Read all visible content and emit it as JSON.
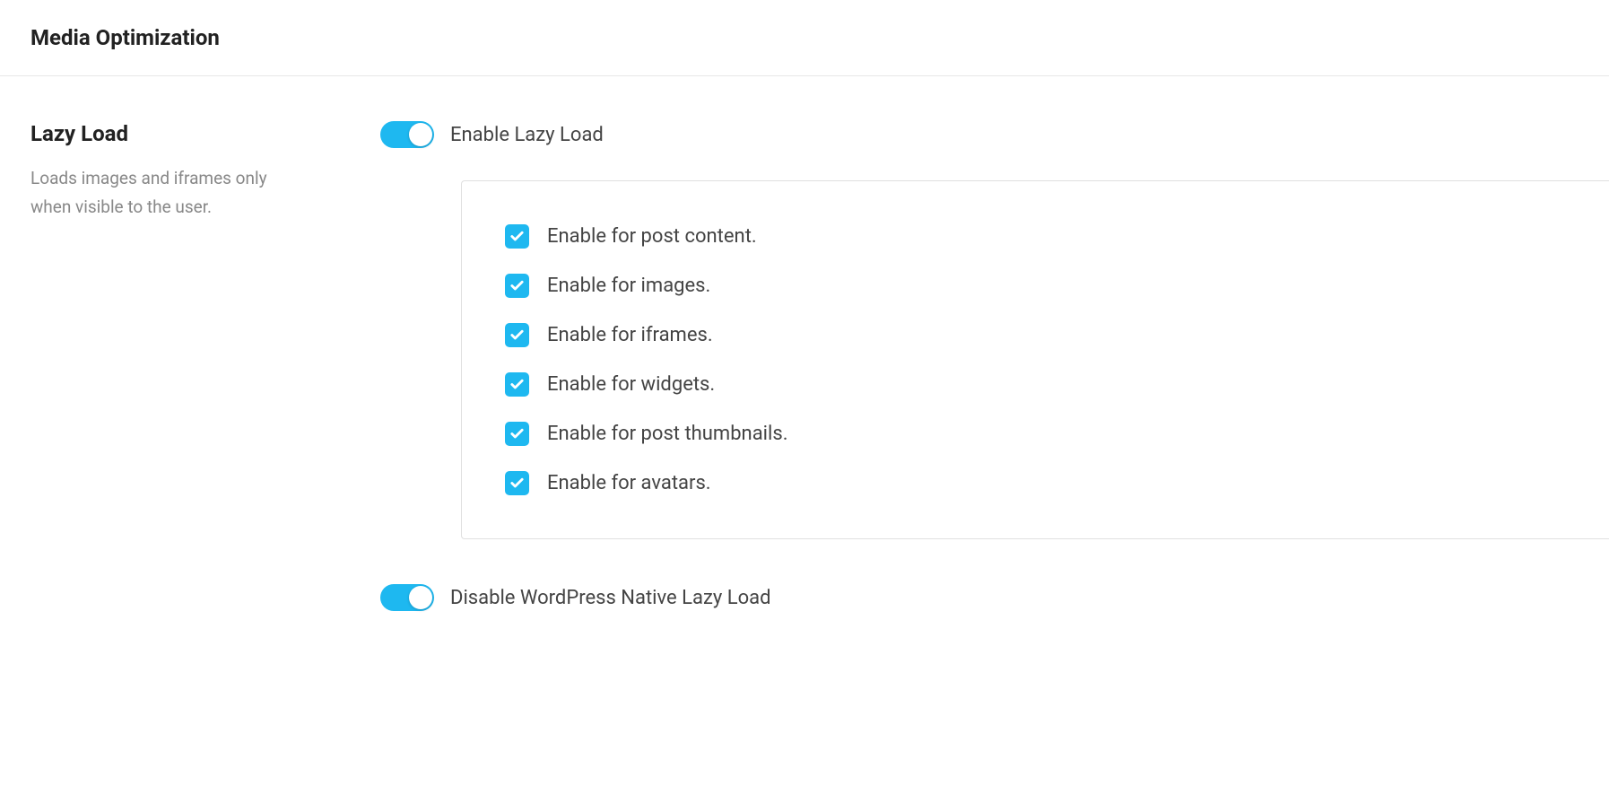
{
  "header": {
    "title": "Media Optimization"
  },
  "section": {
    "title": "Lazy Load",
    "description": "Loads images and iframes only when visible to the user."
  },
  "toggles": {
    "enable_lazy_load": {
      "label": "Enable Lazy Load",
      "checked": true
    },
    "disable_native": {
      "label": "Disable WordPress Native Lazy Load",
      "checked": true
    }
  },
  "options": [
    {
      "label": "Enable for post content.",
      "checked": true
    },
    {
      "label": "Enable for images.",
      "checked": true
    },
    {
      "label": "Enable for iframes.",
      "checked": true
    },
    {
      "label": "Enable for widgets.",
      "checked": true
    },
    {
      "label": "Enable for post thumbnails.",
      "checked": true
    },
    {
      "label": "Enable for avatars.",
      "checked": true
    }
  ]
}
